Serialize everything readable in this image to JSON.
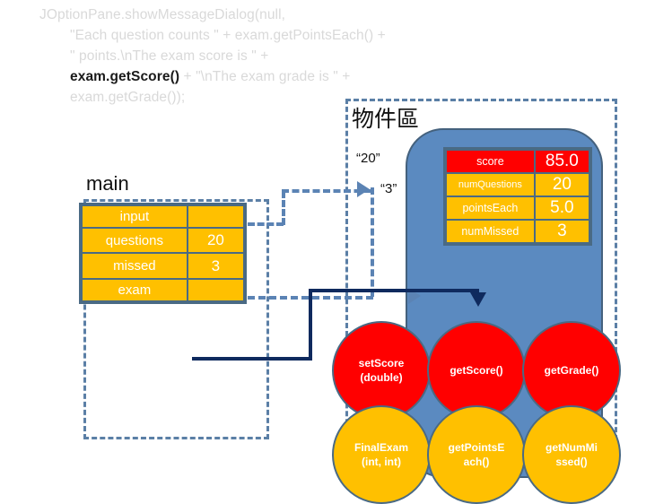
{
  "code": {
    "lines": [
      {
        "text": "JOptionPane.showMessageDialog(null,",
        "indent": false,
        "strong": false
      },
      {
        "text": "\"Each question counts \" + exam.getPointsEach() +",
        "indent": true,
        "strong": false
      },
      {
        "text": "\" points.\\nThe exam score is \" +",
        "indent": true,
        "strong": false
      }
    ],
    "line4_strong": "exam.getScore()",
    "line4_rest": " + \"\\nThe exam grade is \" +",
    "line5": "exam.getGrade());"
  },
  "main_region": {
    "caption": "main",
    "rows": [
      {
        "name": "input",
        "value": ""
      },
      {
        "name": "questions",
        "value": "20"
      },
      {
        "name": "missed",
        "value": "3"
      },
      {
        "name": "exam",
        "value": ""
      }
    ]
  },
  "object_region": {
    "caption": "物件區",
    "labels": {
      "arg_questions": "“20”",
      "arg_missed": "“3”"
    },
    "attributes": [
      {
        "name": "score",
        "value": "85.0",
        "highlight": true
      },
      {
        "name": "numQuestions",
        "value": "20",
        "highlight": false
      },
      {
        "name": "pointsEach",
        "value": "5.0",
        "highlight": false
      },
      {
        "name": "numMissed",
        "value": "3",
        "highlight": false
      }
    ],
    "methods": [
      {
        "label": "setScore\n(double)",
        "color": "red"
      },
      {
        "label": "getScore()",
        "color": "red"
      },
      {
        "label": "getGrade()",
        "color": "red"
      },
      {
        "label": "FinalExam\n(int, int)",
        "color": "orange"
      },
      {
        "label": "getPointsE\nach()",
        "color": "orange"
      },
      {
        "label": "getNumMi\nssed()",
        "color": "orange"
      }
    ]
  },
  "colors": {
    "attribute_fill": "#ffc000",
    "highlight_fill": "#ff0000",
    "object_fill": "#5b8ac0",
    "table_border": "#4a6a84",
    "dashed_connector": "#5b83b4",
    "solid_connector": "#0f2a5e",
    "code_dim": "#d9d9d9",
    "code_strong": "#1a1a1a"
  }
}
